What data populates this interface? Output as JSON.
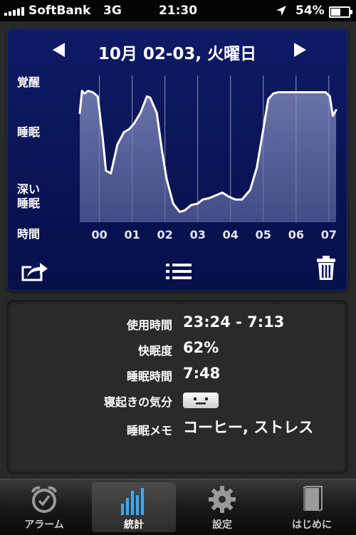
{
  "status_bar": {
    "carrier": "SoftBank",
    "network": "3G",
    "time": "21:30",
    "battery": "54%",
    "battery_level": 0.54
  },
  "graph": {
    "date_title": "10月 02-03, 火曜日",
    "y_labels": {
      "awake": "覚醒",
      "sleep": "睡眠",
      "deep_sleep_line1": "深い",
      "deep_sleep_line2": "睡眠",
      "time": "時間"
    }
  },
  "chart_data": {
    "type": "area",
    "x_ticks": [
      "00",
      "01",
      "02",
      "03",
      "04",
      "05",
      "06",
      "07"
    ],
    "y_categories": [
      "深い睡眠",
      "睡眠",
      "覚醒"
    ],
    "xlim": [
      23.4,
      31.22
    ],
    "ylim": [
      0,
      1
    ],
    "x": [
      23.4,
      23.47,
      23.55,
      23.65,
      23.8,
      23.95,
      24.1,
      24.2,
      24.35,
      24.55,
      24.75,
      24.9,
      25.05,
      25.25,
      25.45,
      25.55,
      25.75,
      25.9,
      26.05,
      26.25,
      26.45,
      26.6,
      26.8,
      27.0,
      27.15,
      27.35,
      27.55,
      27.75,
      27.95,
      28.15,
      28.35,
      28.6,
      28.8,
      29.0,
      29.15,
      29.3,
      29.45,
      29.6,
      29.8,
      30.0,
      30.3,
      30.6,
      30.9,
      31.03,
      31.12,
      31.22
    ],
    "y": [
      0.78,
      0.94,
      0.92,
      0.94,
      0.93,
      0.9,
      0.6,
      0.36,
      0.34,
      0.55,
      0.64,
      0.66,
      0.7,
      0.78,
      0.9,
      0.89,
      0.78,
      0.52,
      0.3,
      0.12,
      0.06,
      0.07,
      0.11,
      0.12,
      0.15,
      0.16,
      0.18,
      0.2,
      0.17,
      0.15,
      0.15,
      0.22,
      0.38,
      0.66,
      0.88,
      0.92,
      0.93,
      0.93,
      0.93,
      0.93,
      0.93,
      0.93,
      0.93,
      0.9,
      0.76,
      0.8
    ]
  },
  "toolbar": {
    "share_icon": "share-icon",
    "list_icon": "list-icon",
    "trash_icon": "trash-icon"
  },
  "stats": {
    "usage_label": "使用時間",
    "usage_value": "23:24 - 7:13",
    "quality_label": "快眠度",
    "quality_value": "62%",
    "sleep_time_label": "睡眠時間",
    "sleep_time_value": "7:48",
    "mood_label": "寝起きの気分",
    "mood_icon": "neutral-face-icon",
    "memo_label": "睡眠メモ",
    "memo_value": "コーヒー, ストレス"
  },
  "tabs": [
    {
      "label": "アラーム",
      "icon": "alarm-clock-icon",
      "selected": false
    },
    {
      "label": "統計",
      "icon": "bar-chart-icon",
      "selected": true
    },
    {
      "label": "設定",
      "icon": "gear-icon",
      "selected": false
    },
    {
      "label": "はじめに",
      "icon": "book-icon",
      "selected": false
    }
  ]
}
